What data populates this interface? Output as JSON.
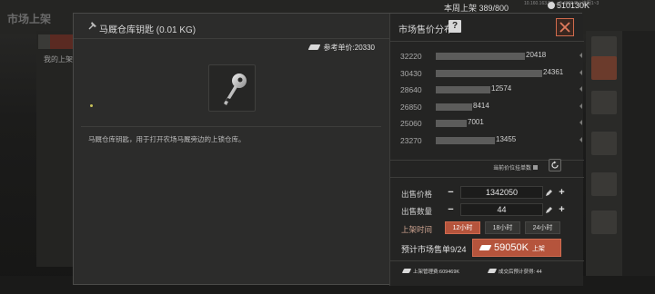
{
  "background": {
    "title": "市场上架",
    "week_listing": "本周上架  389/800",
    "currency_amount": "510130K",
    "debug_text": "10.160.163.52:....0.460045 | 选服1~3",
    "left_panel_text": "我的上架"
  },
  "item": {
    "title": "马厩仓库钥匙 (0.01 KG)",
    "reference_price": "参考单价:20330",
    "description": "马厩仓库钥匙，用于打开农场马厩旁边的上锁仓库。"
  },
  "market": {
    "title": "市场售价分布",
    "help": "?",
    "lowest_price_label": "当前价位挂单数"
  },
  "chart_data": {
    "type": "bar",
    "orientation": "horizontal",
    "categories": [
      "32220",
      "30430",
      "28640",
      "26850",
      "25060",
      "23270"
    ],
    "values": [
      20418,
      24361,
      12574,
      8414,
      7001,
      13455
    ],
    "xlim": [
      0,
      25000
    ]
  },
  "form": {
    "price_label": "出售价格",
    "price_value": "1342050",
    "quantity_label": "出售数量",
    "quantity_value": "44",
    "time_label": "上架时间",
    "time_options": [
      "12小时",
      "18小时",
      "24小时"
    ],
    "time_selected_index": 0,
    "estimate_label": "预计市场售单9/24",
    "list_amount": "59050K",
    "list_action": "上架",
    "fee_label": "上架管理费:609469K",
    "income_label": "成交后预计获得: 44"
  },
  "colors": {
    "accent": "#b5543c",
    "bar": "#5c5c5b",
    "panel": "#2c2c2b"
  }
}
